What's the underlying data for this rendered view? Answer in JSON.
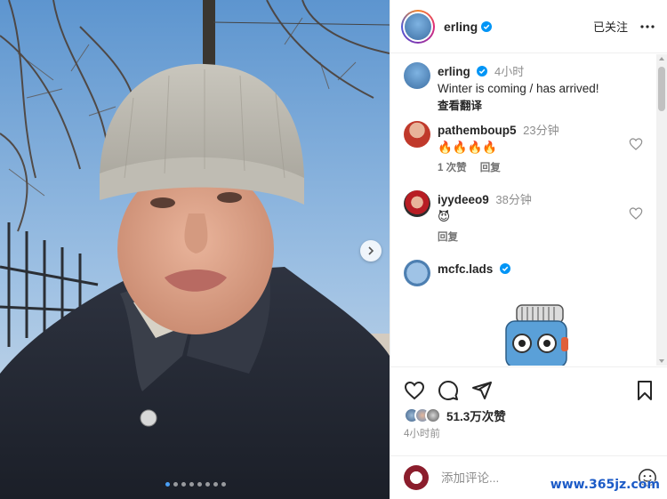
{
  "post": {
    "author": "erling",
    "follow_status": "已关注",
    "caption": {
      "user": "erling",
      "time": "4小时",
      "text": "Winter is coming / has arrived!",
      "translate": "查看翻译"
    },
    "image_dots": 8,
    "active_dot": 0
  },
  "comments": [
    {
      "user": "pathemboup5",
      "time": "23分钟",
      "text": "🔥🔥🔥🔥",
      "likes": "1 次赞",
      "reply": "回复"
    },
    {
      "user": "iyydeeo9",
      "time": "38分钟",
      "text": "😈",
      "reply": "回复"
    },
    {
      "user": "mcfc.lads",
      "verified": true
    }
  ],
  "engagement": {
    "likes": "51.3万次赞",
    "posted": "4小时前"
  },
  "composer": {
    "placeholder": "添加评论..."
  },
  "watermark": "www.365jz.com",
  "colors": {
    "verified": "#0095f6",
    "accent": "#0095f6",
    "dot_active": "#4a9ff5"
  }
}
